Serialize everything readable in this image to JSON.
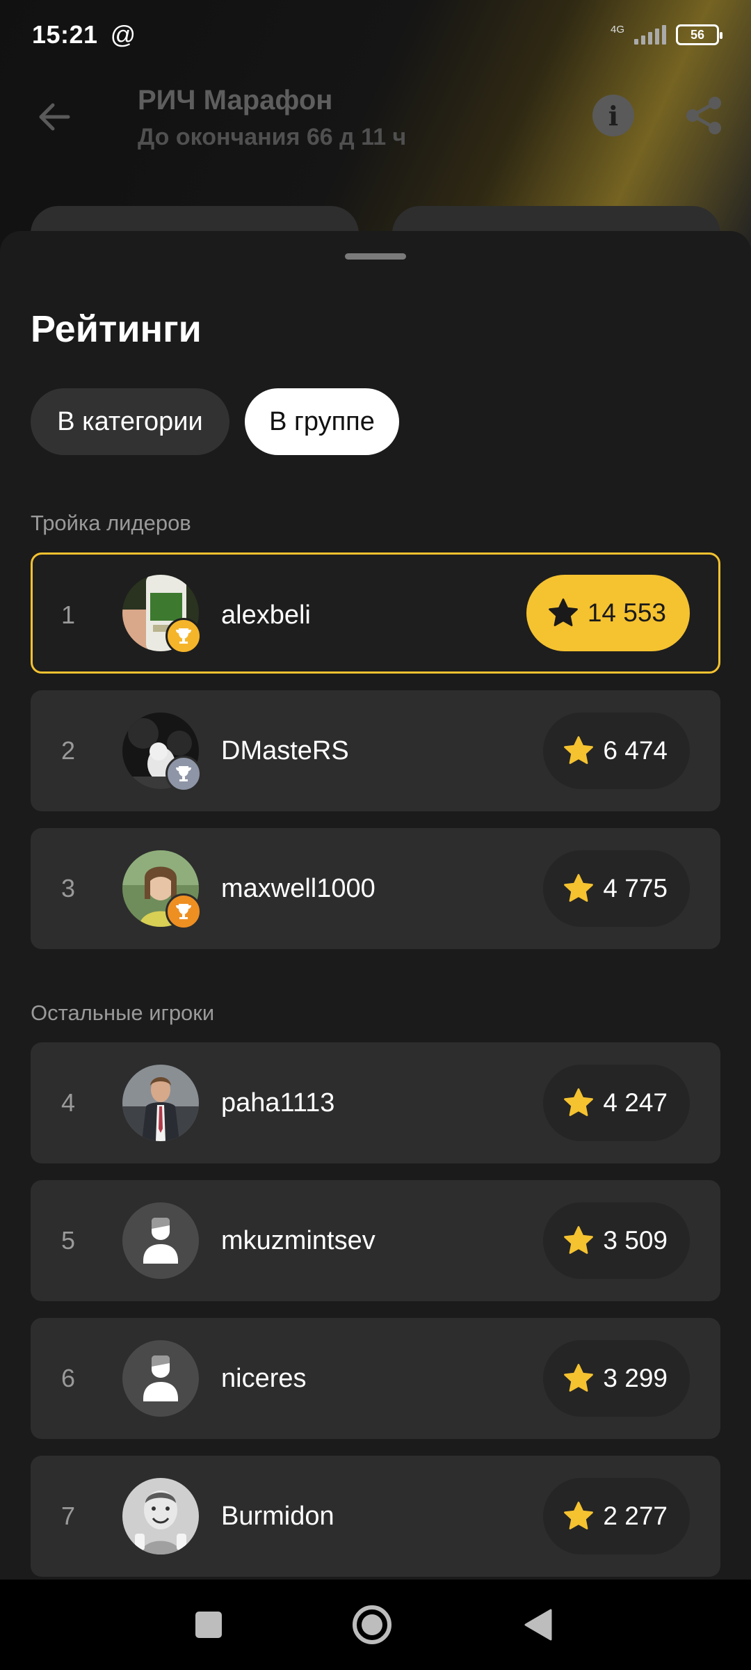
{
  "status_bar": {
    "time": "15:21",
    "at_icon": "@",
    "network": "4G",
    "battery": "56"
  },
  "app_bar": {
    "title": "РИЧ Марафон",
    "subtitle": "До окончания 66 д 11 ч",
    "back_icon": "arrow-left-icon",
    "info_icon": "info-icon",
    "share_icon": "share-icon"
  },
  "sheet": {
    "title": "Рейтинги",
    "tabs": [
      {
        "label": "В категории",
        "active": false
      },
      {
        "label": "В группе",
        "active": true
      }
    ],
    "leaders_label": "Тройка лидеров",
    "others_label": "Остальные игроки"
  },
  "colors": {
    "accent": "#f5c230",
    "gold": "#f5b52a",
    "silver": "#8e95a6",
    "bronze": "#ee8f22"
  },
  "leaders": [
    {
      "rank": "1",
      "name": "alexbeli",
      "score": "14 553",
      "trophy": "gold-trophy-icon",
      "avatar": "photo"
    },
    {
      "rank": "2",
      "name": "DMasteRS",
      "score": "6 474",
      "trophy": "silver-trophy-icon",
      "avatar": "photo"
    },
    {
      "rank": "3",
      "name": "maxwell1000",
      "score": "4 775",
      "trophy": "bronze-trophy-icon",
      "avatar": "photo"
    }
  ],
  "others": [
    {
      "rank": "4",
      "name": "paha1113",
      "score": "4 247",
      "avatar": "photo"
    },
    {
      "rank": "5",
      "name": "mkuzmintsev",
      "score": "3 509",
      "avatar": "default-user-icon"
    },
    {
      "rank": "6",
      "name": "niceres",
      "score": "3 299",
      "avatar": "default-user-icon"
    },
    {
      "rank": "7",
      "name": "Burmidon",
      "score": "2 277",
      "avatar": "photo"
    }
  ],
  "nav": {
    "recents": "square-recents-icon",
    "home": "circle-home-icon",
    "back": "triangle-back-icon"
  }
}
